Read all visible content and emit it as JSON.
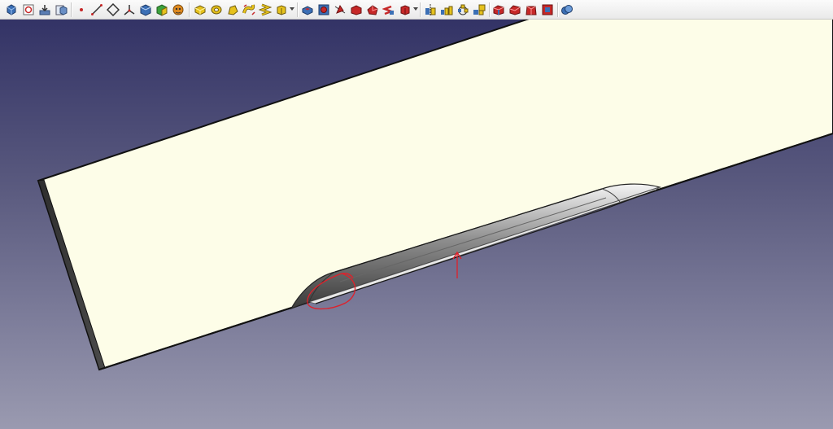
{
  "toolbar": {
    "icons": [
      {
        "name": "part-body-icon",
        "color": "#3b6fb5"
      },
      {
        "name": "new-sketch-icon",
        "color": "#c62828"
      },
      {
        "name": "import-icon",
        "color": "#5b7fb5"
      },
      {
        "name": "create-part-icon",
        "color": "#6a8fc5"
      },
      {
        "name": "point-icon",
        "color": "#c62828"
      },
      {
        "name": "line-icon",
        "color": "#333333"
      },
      {
        "name": "plane-icon",
        "color": "#333333"
      },
      {
        "name": "coordinate-system-icon",
        "color": "#333333"
      },
      {
        "name": "shape-binder-icon",
        "color": "#3b6fb5"
      },
      {
        "name": "subshape-binder-icon",
        "color": "#3ca23c"
      },
      {
        "name": "clone-icon",
        "color": "#e08a1e"
      },
      {
        "name": "pad-icon",
        "color": "#e6c21c"
      },
      {
        "name": "revolution-icon",
        "color": "#e6c21c"
      },
      {
        "name": "additive-loft-icon",
        "color": "#e6c21c"
      },
      {
        "name": "additive-pipe-icon",
        "color": "#e6c21c"
      },
      {
        "name": "additive-helix-icon",
        "color": "#e6c21c"
      },
      {
        "name": "additive-primitive-icon",
        "color": "#e6c21c"
      },
      {
        "name": "pocket-icon",
        "color": "#c62828"
      },
      {
        "name": "hole-icon",
        "color": "#c62828"
      },
      {
        "name": "groove-icon",
        "color": "#c62828"
      },
      {
        "name": "subtractive-loft-icon",
        "color": "#c62828"
      },
      {
        "name": "subtractive-pipe-icon",
        "color": "#c62828"
      },
      {
        "name": "subtractive-helix-icon",
        "color": "#c62828"
      },
      {
        "name": "subtractive-primitive-icon",
        "color": "#c62828"
      },
      {
        "name": "mirrored-icon",
        "color": "#e6c21c"
      },
      {
        "name": "linear-pattern-icon",
        "color": "#e6c21c"
      },
      {
        "name": "polar-pattern-icon",
        "color": "#e6c21c"
      },
      {
        "name": "multitransform-icon",
        "color": "#e6c21c"
      },
      {
        "name": "fillet-icon",
        "color": "#c62828"
      },
      {
        "name": "chamfer-icon",
        "color": "#c62828"
      },
      {
        "name": "draft-icon",
        "color": "#c62828"
      },
      {
        "name": "thickness-icon",
        "color": "#c62828"
      },
      {
        "name": "boolean-icon",
        "color": "#3b6fb5"
      }
    ]
  },
  "viewport": {
    "model_face_color": "#fdfde8",
    "annotation_color": "#e0202a"
  }
}
